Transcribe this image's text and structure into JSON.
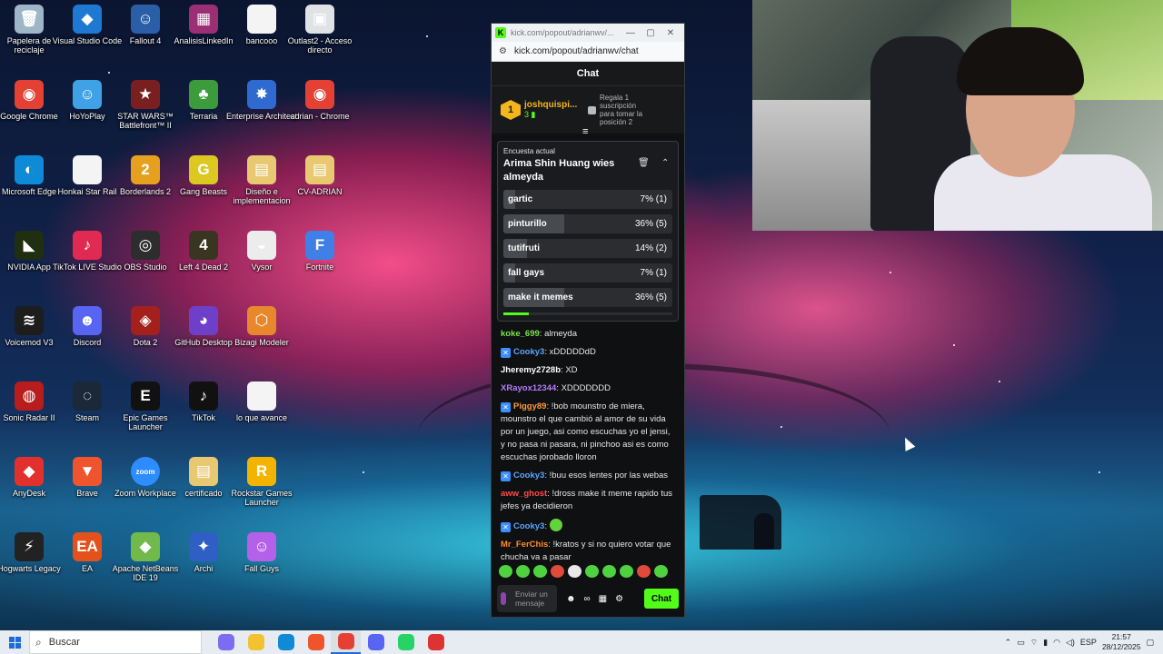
{
  "desktop": {
    "icons": [
      {
        "label": "Papelera de reciclaje",
        "color": "#9fb6c8",
        "glyph": "🗑"
      },
      {
        "label": "Visual Studio Code",
        "color": "#1f78d1",
        "glyph": "◆"
      },
      {
        "label": "Fallout 4",
        "color": "#2a5fa8",
        "glyph": "☺"
      },
      {
        "label": "AnalisisLinkedIn",
        "color": "#9b2f76",
        "glyph": "▦"
      },
      {
        "label": "bancooo",
        "color": "#f4f4f4",
        "glyph": ""
      },
      {
        "label": "Outlast2 - Acceso directo",
        "color": "#dfe3e6",
        "glyph": "▣"
      },
      {
        "label": "Google Chrome",
        "color": "#e44134",
        "glyph": "◉"
      },
      {
        "label": "HoYoPlay",
        "color": "#3fa2e6",
        "glyph": "☺"
      },
      {
        "label": "STAR WARS™ Battlefront™ II",
        "color": "#7a1f1f",
        "glyph": "★"
      },
      {
        "label": "Terraria",
        "color": "#3c9b3a",
        "glyph": "♣"
      },
      {
        "label": "Enterprise Architect",
        "color": "#2f6ad1",
        "glyph": "✸"
      },
      {
        "label": "adrian - Chrome",
        "color": "#e44134",
        "glyph": "◉"
      },
      {
        "label": "Microsoft Edge",
        "color": "#0f8ad7",
        "glyph": "◐"
      },
      {
        "label": "Honkai Star Rail",
        "color": "#f4f4f4",
        "glyph": ""
      },
      {
        "label": "Borderlands 2",
        "color": "#e5a11d",
        "glyph": "2"
      },
      {
        "label": "Gang Beasts",
        "color": "#dcc820",
        "glyph": "G"
      },
      {
        "label": "Diseño e implementacion",
        "color": "#e8c870",
        "glyph": "▤"
      },
      {
        "label": "CV-ADRIAN",
        "color": "#e8c870",
        "glyph": "▤"
      },
      {
        "label": "NVIDIA App",
        "color": "#1f2f10",
        "glyph": "◣"
      },
      {
        "label": "TikTok LIVE Studio",
        "color": "#e02a52",
        "glyph": "♪"
      },
      {
        "label": "OBS Studio",
        "color": "#2d2d2d",
        "glyph": "◎"
      },
      {
        "label": "Left 4 Dead 2",
        "color": "#3a3520",
        "glyph": "4"
      },
      {
        "label": "Vysor",
        "color": "#ececec",
        "glyph": "◒"
      },
      {
        "label": "Fortnite",
        "color": "#3f7fe6",
        "glyph": "F"
      },
      {
        "label": "Voicemod V3",
        "color": "#1d1d1d",
        "glyph": "≋"
      },
      {
        "label": "Discord",
        "color": "#5865f2",
        "glyph": "☻"
      },
      {
        "label": "Dota 2",
        "color": "#a3201c",
        "glyph": "◈"
      },
      {
        "label": "GitHub Desktop",
        "color": "#6e40c9",
        "glyph": "◕"
      },
      {
        "label": "Bizagi Modeler",
        "color": "#e8872b",
        "glyph": "⬡"
      },
      {
        "label": "Sonic Radar II",
        "color": "#b81c1c",
        "glyph": "◍"
      },
      {
        "label": "Steam",
        "color": "#1b2838",
        "glyph": "◌"
      },
      {
        "label": "Epic Games Launcher",
        "color": "#111111",
        "glyph": "E"
      },
      {
        "label": "TikTok",
        "color": "#111111",
        "glyph": "♪"
      },
      {
        "label": "lo que avance",
        "color": "#f4f4f4",
        "glyph": ""
      },
      {
        "label": "AnyDesk",
        "color": "#e2302c",
        "glyph": "◆"
      },
      {
        "label": "Brave",
        "color": "#f0542d",
        "glyph": "▼"
      },
      {
        "label": "Zoom Workplace",
        "color": "#2d8cff",
        "glyph": "zoom"
      },
      {
        "label": "certificado",
        "color": "#e8c870",
        "glyph": "▤"
      },
      {
        "label": "Rockstar Games Launcher",
        "color": "#f3b400",
        "glyph": "R"
      },
      {
        "label": "Hogwarts Legacy",
        "color": "#222222",
        "glyph": "⚡"
      },
      {
        "label": "EA",
        "color": "#e4511d",
        "glyph": "EA"
      },
      {
        "label": "Apache NetBeans IDE 19",
        "color": "#71b94a",
        "glyph": "◆"
      },
      {
        "label": "Archi",
        "color": "#2f5fc4",
        "glyph": "✦"
      },
      {
        "label": "Fall Guys",
        "color": "#b560e8",
        "glyph": "☺"
      }
    ]
  },
  "browser": {
    "tab_title": "kick.com/popout/adrianwv/...",
    "url": "kick.com/popout/adrianwv/chat",
    "chat_header": "Chat",
    "pinned": {
      "rank": "1",
      "user": "joshquispi...",
      "count": "3",
      "gift_text_1": "Regala 1",
      "gift_text_2": "suscripción",
      "gift_text_3": "para tomar la",
      "gift_text_4": "posición 2"
    },
    "poll": {
      "label": "Encuesta actual",
      "title": "Arima Shin Huang wies almeyda",
      "options": [
        {
          "name": "gartic",
          "pct": "7% (1)",
          "share": 7
        },
        {
          "name": "pinturillo",
          "pct": "36% (5)",
          "share": 36
        },
        {
          "name": "tutifruti",
          "pct": "14% (2)",
          "share": 14
        },
        {
          "name": "fall gays",
          "pct": "7% (1)",
          "share": 7
        },
        {
          "name": "make it memes",
          "pct": "36% (5)",
          "share": 36
        }
      ],
      "timer_remaining": 15
    },
    "messages": [
      {
        "user": "koke_699",
        "color": "#7ce34a",
        "badge": false,
        "text": "almeyda"
      },
      {
        "user": "Cooky3",
        "color": "#5aa7ff",
        "badge": true,
        "text": "xDDDDDdD"
      },
      {
        "user": "Jheremy2728b",
        "color": "#ffffff",
        "badge": false,
        "text": "XD"
      },
      {
        "user": "XRayox12344",
        "color": "#b57cff",
        "badge": false,
        "text": "XDDDDDDD"
      },
      {
        "user": "Piggy89",
        "color": "#ff9a3c",
        "badge": true,
        "text": "!bob mounstro de miera, mounstro el que cambió al amor de su vida por un juego, asi como escuchas yo el jensi, y no pasa ni pasara, ni pinchoo asi es como escuchas jorobado lloron"
      },
      {
        "user": "Cooky3",
        "color": "#5aa7ff",
        "badge": true,
        "text": "!buu esos lentes por las webas"
      },
      {
        "user": "aww_ghost",
        "color": "#ff4b4b",
        "badge": false,
        "text": "!dross make it meme rapido tus jefes ya decidieron"
      },
      {
        "user": "Cooky3",
        "color": "#5aa7ff",
        "badge": true,
        "text": ""
      },
      {
        "user": "Mr_FerChis",
        "color": "#ff8c2a",
        "badge": false,
        "text": "!kratos y si no quiero votar que chucha va a pasar"
      }
    ],
    "composer": {
      "placeholder": "Enviar un mensaje",
      "send_label": "Chat"
    }
  },
  "taskbar": {
    "search_placeholder": "Buscar",
    "apps": [
      {
        "name": "copilot",
        "color": "#7b6cf0"
      },
      {
        "name": "file-explorer",
        "color": "#f2c230"
      },
      {
        "name": "edge",
        "color": "#0f8ad7"
      },
      {
        "name": "brave",
        "color": "#f0542d"
      },
      {
        "name": "chrome",
        "color": "#e44134",
        "active": true
      },
      {
        "name": "discord",
        "color": "#5865f2"
      },
      {
        "name": "whatsapp",
        "color": "#25d366"
      },
      {
        "name": "kick-app",
        "color": "#d33"
      }
    ],
    "lang": "ESP",
    "time": "21:57",
    "date": "28/12/2025"
  }
}
